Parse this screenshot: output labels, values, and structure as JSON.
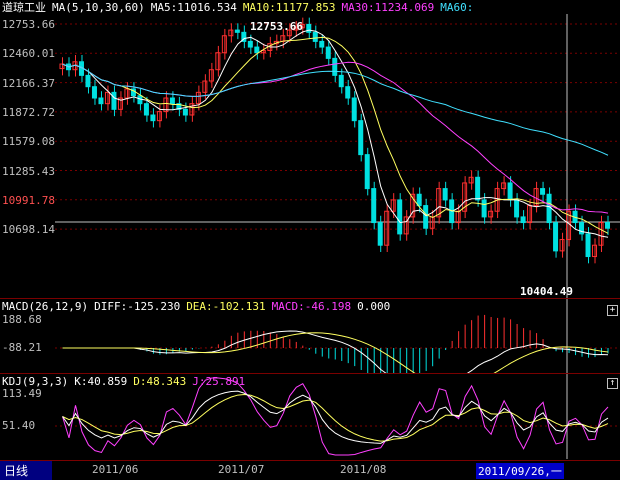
{
  "main_chart": {
    "legend": {
      "symbol": "道琼工业",
      "ma_title": "MA(5,10,30,60)",
      "ma5": "MA5:11016.534",
      "ma10": "MA10:11177.853",
      "ma30": "MA30:11234.069",
      "ma60": "MA60:"
    },
    "y_labels": [
      "12753.66",
      "12460.01",
      "12166.37",
      "11872.72",
      "11579.08",
      "11285.43",
      "10991.78",
      "10698.14"
    ],
    "high_label": "12753.66",
    "low_label": "10404.49",
    "colors": {
      "up": "#ff3030",
      "down": "#00e0e0",
      "ma5": "#ffffff",
      "ma10": "#ffff60",
      "ma30": "#ff40ff",
      "ma60": "#40e0ff"
    }
  },
  "macd": {
    "legend": {
      "title": "MACD(26,12,9)",
      "diff": "DIFF:-125.230",
      "dea": "DEA:-102.131",
      "macd": "MACD:-46.198",
      "extra": "0.000"
    },
    "y_labels": [
      "188.68",
      "-88.21"
    ]
  },
  "kdj": {
    "legend": {
      "title": "KDJ(9,3,3)",
      "k": "K:40.859",
      "d": "D:48.343",
      "j": "J:25.891"
    },
    "y_labels": [
      "113.49",
      "51.40"
    ]
  },
  "bottom_bar": {
    "period": "日线",
    "dates": [
      "2011/06",
      "2011/07",
      "2011/08"
    ],
    "cursor_date": "2011/09/26,一"
  },
  "corner_buttons": {
    "plus": "+",
    "plus2": "+",
    "up": "↑"
  },
  "chart_data": {
    "type": "line",
    "title": "道琼工业",
    "ylim": [
      10404.49,
      12753.66
    ],
    "closes": [
      12400,
      12350,
      12420,
      12300,
      12200,
      12100,
      12050,
      12150,
      12000,
      12100,
      12180,
      12120,
      12050,
      11950,
      11900,
      11980,
      12100,
      12050,
      12000,
      11950,
      12050,
      12150,
      12250,
      12350,
      12500,
      12650,
      12700,
      12680,
      12600,
      12550,
      12500,
      12520,
      12580,
      12600,
      12650,
      12700,
      12720,
      12750,
      12680,
      12600,
      12550,
      12450,
      12300,
      12200,
      12100,
      11900,
      11600,
      11300,
      11000,
      10800,
      11100,
      11200,
      10900,
      11050,
      11250,
      11150,
      10950,
      11050,
      11300,
      11200,
      11000,
      11100,
      11350,
      11400,
      11200,
      11050,
      11100,
      11300,
      11350,
      11200,
      11050,
      11000,
      11150,
      11300,
      11250,
      11000,
      10750,
      10850,
      11100,
      11000,
      10900,
      10700,
      10800,
      11000,
      10950
    ]
  }
}
